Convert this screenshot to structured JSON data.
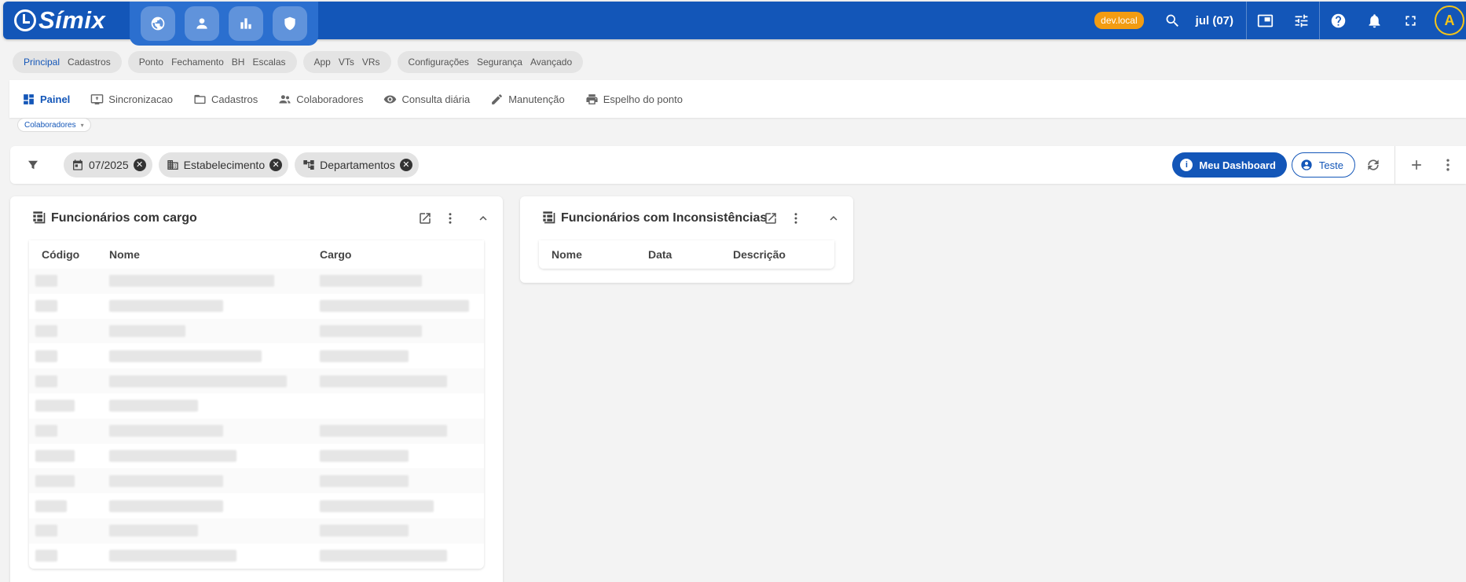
{
  "app": {
    "brand": "Símix",
    "env_badge": "dev.local",
    "period": "jul (07)",
    "avatar_initial": "A"
  },
  "categories": [
    {
      "items": [
        "Principal",
        "Cadastros"
      ],
      "active": "Principal"
    },
    {
      "items": [
        "Ponto",
        "Fechamento",
        "BH",
        "Escalas"
      ]
    },
    {
      "items": [
        "App",
        "VTs",
        "VRs"
      ]
    },
    {
      "items": [
        "Configurações",
        "Segurança",
        "Avançado"
      ]
    }
  ],
  "nav": {
    "items": [
      {
        "label": "Painel",
        "icon": "dashboard-icon"
      },
      {
        "label": "Sincronizacao",
        "icon": "sync-screen-icon"
      },
      {
        "label": "Cadastros",
        "icon": "folder-icon"
      },
      {
        "label": "Colaboradores",
        "icon": "people-icon"
      },
      {
        "label": "Consulta diária",
        "icon": "eye-icon"
      },
      {
        "label": "Manutenção",
        "icon": "pencil-icon"
      },
      {
        "label": "Espelho do ponto",
        "icon": "printer-icon"
      }
    ]
  },
  "section_tag": "Colaboradores",
  "filters": {
    "chips": [
      {
        "label": "07/2025",
        "icon": "calendar-icon"
      },
      {
        "label": "Estabelecimento",
        "icon": "building-icon"
      },
      {
        "label": "Departamentos",
        "icon": "hierarchy-icon"
      }
    ],
    "primary_button": "Meu Dashboard",
    "outline_button": "Teste"
  },
  "cards": {
    "cargo": {
      "title": "Funcionários com cargo",
      "columns": [
        "Código",
        "Nome",
        "Cargo"
      ],
      "row_count": 12
    },
    "inconsistencias": {
      "title": "Funcionários com Inconsistências",
      "columns": [
        "Nome",
        "Data",
        "Descrição"
      ]
    }
  },
  "colors": {
    "primary": "#1356b8",
    "badge": "#f39c12",
    "avatar": "#f5c518"
  }
}
